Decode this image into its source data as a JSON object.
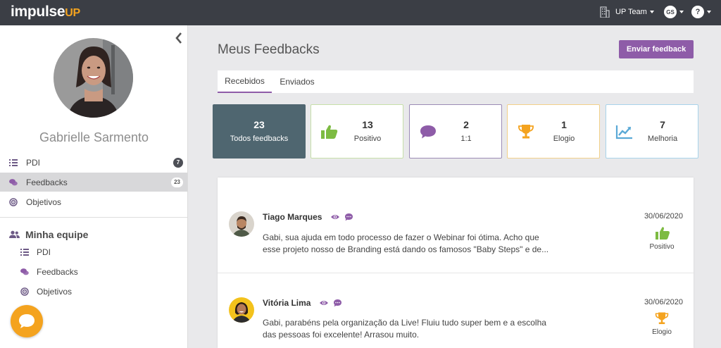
{
  "brand": {
    "part1": "impulse",
    "part2": "UP"
  },
  "topbar": {
    "team_label": "UP Team",
    "user_initials": "GS",
    "help_label": "?"
  },
  "sidebar": {
    "profile_name": "Gabrielle Sarmento",
    "items": [
      {
        "label": "PDI",
        "badge": "7"
      },
      {
        "label": "Feedbacks",
        "badge": "23"
      },
      {
        "label": "Objetivos"
      }
    ],
    "team_section": {
      "title": "Minha equipe",
      "items": [
        {
          "label": "PDI"
        },
        {
          "label": "Feedbacks"
        },
        {
          "label": "Objetivos"
        }
      ]
    }
  },
  "main": {
    "title": "Meus Feedbacks",
    "send_button": "Enviar feedback",
    "tabs": [
      {
        "label": "Recebidos"
      },
      {
        "label": "Enviados"
      }
    ],
    "stats": [
      {
        "count": "23",
        "label": "Todos feedbacks"
      },
      {
        "count": "13",
        "label": "Positivo",
        "color": "#7dbb42",
        "icon": "thumbs-up-icon"
      },
      {
        "count": "2",
        "label": "1:1",
        "color": "#8e5ca8",
        "icon": "speech-bubble-icon"
      },
      {
        "count": "1",
        "label": "Elogio",
        "color": "#f4a31f",
        "icon": "trophy-icon"
      },
      {
        "count": "7",
        "label": "Melhoria",
        "color": "#5aa9d6",
        "icon": "trend-chart-icon"
      }
    ],
    "feedbacks": [
      {
        "name": "Tiago Marques",
        "text_line1": "Gabi, sua ajuda em todo processo de fazer o Webinar foi ótima. Acho que",
        "text_line2": "esse projeto nosso de Branding está dando os famosos \"Baby Steps\" e de...",
        "date": "30/06/2020",
        "type": "Positivo"
      },
      {
        "name": "Vitória Lima",
        "text_line1": "Gabi, parabéns pela organização da Live! Fluiu tudo super bem e a escolha",
        "text_line2": "das pessoas foi excelente! Arrasou muito.",
        "date": "30/06/2020",
        "type": "Elogio"
      }
    ]
  },
  "colors": {
    "topbar": "#3b3e45",
    "accent_purple": "#8e5ca8",
    "accent_orange": "#f4a31f",
    "total_card": "#4f6670"
  }
}
